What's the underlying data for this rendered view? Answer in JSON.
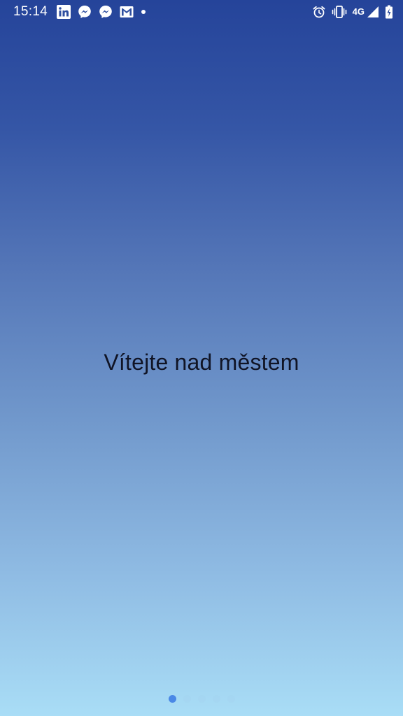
{
  "status_bar": {
    "time": "15:14",
    "notification_icons": [
      "linkedin-icon",
      "messenger-icon",
      "messenger-icon",
      "gmail-icon",
      "more-notifications-dot-icon"
    ],
    "system_icons": [
      "alarm-icon",
      "vibrate-icon",
      "cellular-signal-icon",
      "battery-charging-icon"
    ],
    "network_type": "4G",
    "text_color": "#ffffff"
  },
  "main": {
    "welcome_text": "Vítejte nad městem",
    "text_color": "#101425"
  },
  "pager": {
    "page_count": 5,
    "current_page": 1,
    "active_color": "#4a88e6"
  },
  "background": {
    "gradient_top": "#25449a",
    "gradient_bottom": "#a9ddf6"
  }
}
